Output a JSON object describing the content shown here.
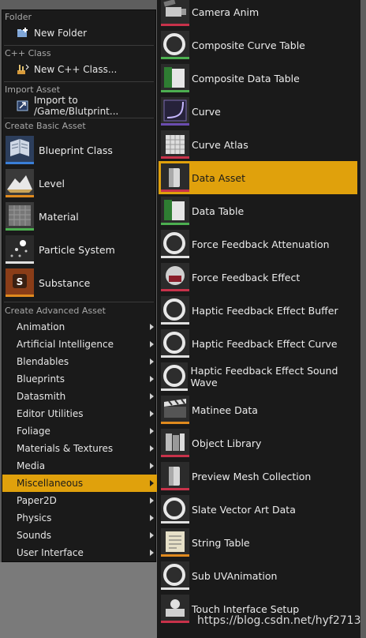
{
  "left_menu": {
    "sections": {
      "folder": "Folder",
      "cpp": "C++ Class",
      "import": "Import Asset",
      "basic": "Create Basic Asset",
      "advanced": "Create Advanced Asset"
    },
    "new_folder": "New Folder",
    "new_cpp": "New C++ Class...",
    "import_to": "Import to /Game/Blutprint...",
    "basic_items": [
      "Blueprint Class",
      "Level",
      "Material",
      "Particle System",
      "Substance"
    ],
    "advanced_items": [
      "Animation",
      "Artificial Intelligence",
      "Blendables",
      "Blueprints",
      "Datasmith",
      "Editor Utilities",
      "Foliage",
      "Materials & Textures",
      "Media",
      "Miscellaneous",
      "Paper2D",
      "Physics",
      "Sounds",
      "User Interface"
    ],
    "selected_advanced": "Miscellaneous"
  },
  "right_menu": {
    "items": [
      "Camera Anim",
      "Composite Curve Table",
      "Composite Data Table",
      "Curve",
      "Curve Atlas",
      "Data Asset",
      "Data Table",
      "Force Feedback Attenuation",
      "Force Feedback Effect",
      "Haptic Feedback Effect Buffer",
      "Haptic Feedback Effect Curve",
      "Haptic Feedback Effect Sound Wave",
      "Matinee Data",
      "Object Library",
      "Preview Mesh Collection",
      "Slate Vector Art Data",
      "String Table",
      "Sub UVAnimation",
      "Touch Interface Setup"
    ],
    "selected": "Data Asset"
  },
  "watermark": "https://blog.csdn.net/hyf2713",
  "colors": {
    "menu_bg": "#1a1a1a",
    "selected": "#e0a10c",
    "green_accent": "#4caf50",
    "orange_accent": "#e08a1e",
    "pink_accent": "#c8324a",
    "blue_accent": "#3a7fd8"
  }
}
